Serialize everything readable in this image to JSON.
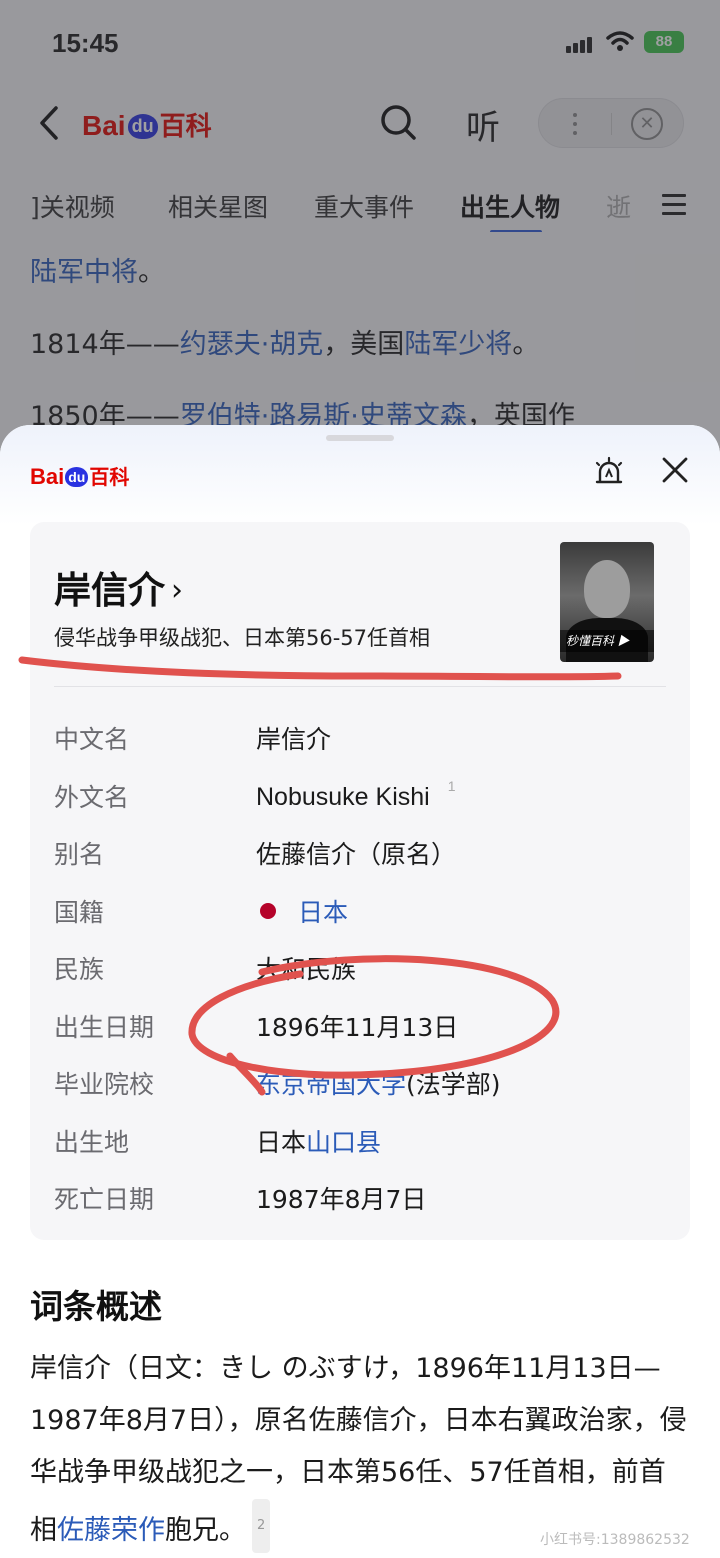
{
  "status": {
    "time": "15:45",
    "battery": "88"
  },
  "nav": {
    "brand_bai": "Bai",
    "brand_du": "du",
    "brand_baike": "百科",
    "listen": "听"
  },
  "tabs": [
    {
      "label": "相关视频",
      "partial": "]关视频"
    },
    {
      "label": "相关星图"
    },
    {
      "label": "重大事件"
    },
    {
      "label": "出生人物"
    },
    {
      "label": "逝"
    }
  ],
  "background": {
    "line1_link": "陆军中将",
    "line1_tail": "。",
    "line2_year": "1814年——",
    "line2_link1": "约瑟夫·胡克",
    "line2_mid": "，美国",
    "line2_link2": "陆军少将",
    "line2_tail": "。",
    "line3_year": "1850年——",
    "line3_link": "罗伯特·路易斯·史蒂文森",
    "line3_tail": "，英国作"
  },
  "sheet": {
    "brand_bai": "Bai",
    "brand_du": "du",
    "brand_baike": "百科",
    "title": "岸信介",
    "title_chevron": "›",
    "subtitle": "侵华战争甲级战犯、日本第56-57任首相",
    "portrait_badge": "秒懂百科 ▶",
    "infobox": [
      {
        "label": "中文名",
        "value": "岸信介"
      },
      {
        "label": "外文名",
        "value": "Nobusuke Kishi",
        "ref": "1"
      },
      {
        "label": "别名",
        "value": "佐藤信介（原名）"
      },
      {
        "label": "国籍",
        "value": "日本",
        "link": true
      },
      {
        "label": "民族",
        "value": "大和民族",
        "link": true
      },
      {
        "label": "出生日期",
        "value": "1896年11月13日"
      },
      {
        "label": "毕业院校",
        "value_link": "东京帝国大学",
        "value_tail": "(法学部)"
      },
      {
        "label": "出生地",
        "value_head": "日本",
        "value_link": "山口县"
      },
      {
        "label": "死亡日期",
        "value": "1987年8月7日"
      }
    ],
    "summary_title": "词条概述",
    "summary_text_1": "岸信介（日文：きし のぶすけ，1896年11月13日—1987年8月7日），原名佐藤信介，日本右翼政治家，侵华战争甲级战犯之一，日本第56任、57任首相，前首相",
    "summary_link": "佐藤荣作",
    "summary_text_2": "胞兄。",
    "summary_ref": "2",
    "watermark": "小红书号:1389862532"
  },
  "colors": {
    "link": "#2b5bb8",
    "brand_red": "#e10601",
    "annotation_red": "#e0524e"
  }
}
